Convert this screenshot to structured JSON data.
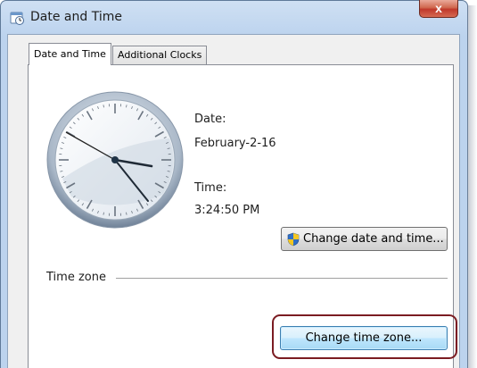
{
  "window": {
    "title": "Date and Time",
    "close_symbol": "x"
  },
  "tabs": [
    {
      "label": "Date and Time",
      "active": true
    },
    {
      "label": "Additional Clocks",
      "active": false
    }
  ],
  "clock": {
    "icon": "analog-clock-icon",
    "time": "3:24:50 PM"
  },
  "date": {
    "label": "Date:",
    "value": "February-2-16"
  },
  "time": {
    "label": "Time:",
    "value": "3:24:50 PM"
  },
  "buttons": {
    "change_date_time": "Change date and time...",
    "change_time_zone": "Change time zone..."
  },
  "time_zone": {
    "heading": "Time zone"
  },
  "colors": {
    "highlight_ring": "#7b1c22",
    "shield_blue": "#2f6fc6",
    "shield_yellow": "#f3c623"
  }
}
